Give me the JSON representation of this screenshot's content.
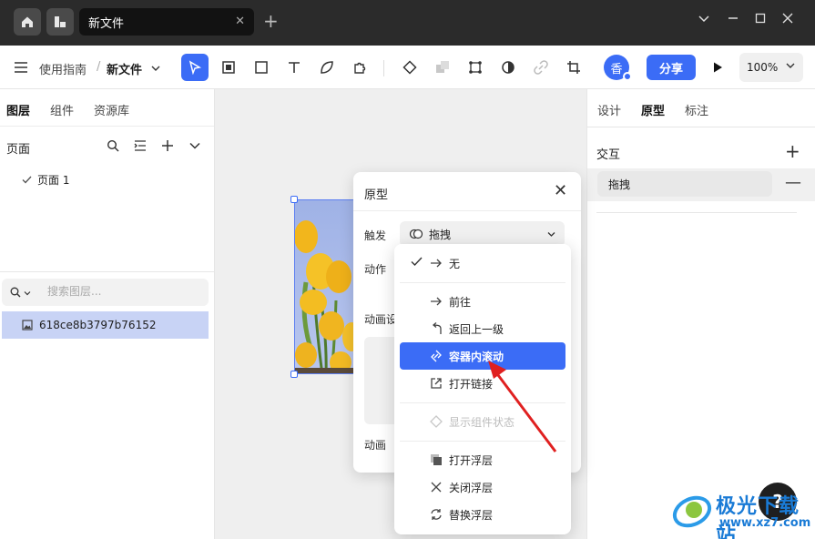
{
  "titlebar": {
    "tab_label": "新文件"
  },
  "toolbar": {
    "breadcrumb_parent": "使用指南",
    "breadcrumb_sep": "/",
    "file_name": "新文件",
    "avatar_initial": "香",
    "share_label": "分享",
    "zoom_level": "100%",
    "accent_color": "#3b6cf6"
  },
  "left_panel": {
    "tabs": [
      "图层",
      "组件",
      "资源库"
    ],
    "pages_label": "页面",
    "pages": [
      {
        "label": "页面 1",
        "checked": true
      }
    ],
    "layer_search_placeholder": "搜索图层...",
    "layers": [
      {
        "label": "618ce8b3797b76152",
        "icon": "image-icon"
      }
    ]
  },
  "right_panel": {
    "tabs": [
      "设计",
      "原型",
      "标注"
    ],
    "active_tab": "原型",
    "interaction_title": "交互",
    "interactions": [
      {
        "label": "拖拽"
      }
    ]
  },
  "prototype_dialog": {
    "title": "原型",
    "trigger_label": "触发",
    "trigger_value": "拖拽",
    "action_label": "动作",
    "anim_settings_label": "动画设",
    "animation_label": "动画"
  },
  "action_menu": {
    "items": [
      {
        "label": "无",
        "icon": "arrow-right-icon",
        "checked": true,
        "selected": false,
        "disabled": false
      },
      {
        "label": "前往",
        "icon": "arrow-right-icon",
        "checked": false,
        "selected": false,
        "disabled": false
      },
      {
        "label": "返回上一级",
        "icon": "back-arrow-icon",
        "checked": false,
        "selected": false,
        "disabled": false
      },
      {
        "label": "容器内滚动",
        "icon": "scroll-link-icon",
        "checked": false,
        "selected": true,
        "disabled": false
      },
      {
        "label": "打开链接",
        "icon": "external-link-icon",
        "checked": false,
        "selected": false,
        "disabled": false
      },
      {
        "label": "显示组件状态",
        "icon": "component-icon",
        "checked": false,
        "selected": false,
        "disabled": true
      },
      {
        "label": "打开浮层",
        "icon": "overlay-icon",
        "checked": false,
        "selected": false,
        "disabled": false
      },
      {
        "label": "关闭浮层",
        "icon": "close-x-icon",
        "checked": false,
        "selected": false,
        "disabled": false
      },
      {
        "label": "替换浮层",
        "icon": "swap-icon",
        "checked": false,
        "selected": false,
        "disabled": false
      }
    ]
  },
  "help": {
    "label": "?"
  },
  "watermark": {
    "text": "极光下载站",
    "url": "www.xz7.com"
  }
}
